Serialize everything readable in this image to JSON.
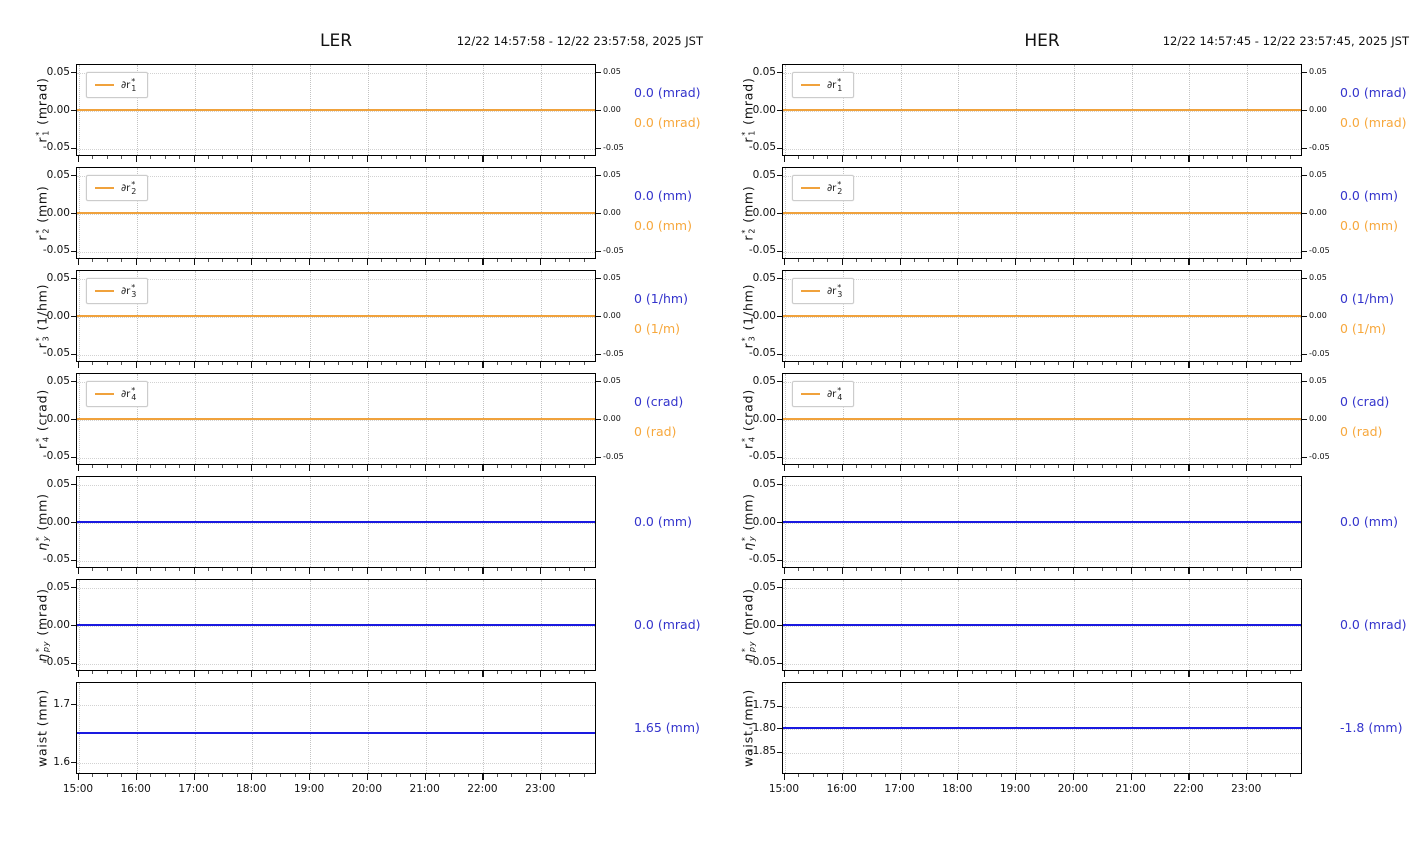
{
  "colors": {
    "orange_line": "#f0a23c",
    "blue_line": "#1a1ae0",
    "orange_text": "#f7a83d",
    "blue_text": "#3434cc",
    "grid": "#c9c9c9",
    "border": "#000000"
  },
  "chart_data": [
    {
      "type": "line",
      "title": "LER",
      "time_range": "12/22 14:57:58 - 12/22 23:57:58, 2025 JST",
      "x_axis": {
        "start": "14:57:58",
        "end": "23:57:58",
        "grid": true
      },
      "x_ticks": [
        {
          "label": "15:00",
          "pos": 0.38
        },
        {
          "label": "16:00",
          "pos": 11.49
        },
        {
          "label": "17:00",
          "pos": 22.6
        },
        {
          "label": "18:00",
          "pos": 33.71
        },
        {
          "label": "19:00",
          "pos": 44.83
        },
        {
          "label": "20:00",
          "pos": 55.94
        },
        {
          "label": "21:00",
          "pos": 67.05
        },
        {
          "label": "22:00",
          "pos": 78.16
        },
        {
          "label": "23:00",
          "pos": 89.27
        }
      ],
      "panels": [
        {
          "id": "r1",
          "ylabel": {
            "base": "r",
            "sup": "*",
            "sub": "1",
            "unit": "(mrad)",
            "italic": false
          },
          "legend": {
            "prefix": "∂r",
            "sup": "*",
            "sub": "1"
          },
          "ylim": [
            -0.055,
            0.055
          ],
          "y_ticks": [
            {
              "label": "0.05",
              "pos": 9
            },
            {
              "label": "0.00",
              "pos": 50
            },
            {
              "label": "-0.05",
              "pos": 91
            }
          ],
          "right_axis": true,
          "series": [
            {
              "name": "∂r1*",
              "color": "orange",
              "value": 0.0,
              "pos": 50
            }
          ],
          "values": [
            {
              "text": "0.0 (mrad)",
              "color": "blue"
            },
            {
              "text": "0.0 (mrad)",
              "color": "orange"
            }
          ]
        },
        {
          "id": "r2",
          "ylabel": {
            "base": "r",
            "sup": "*",
            "sub": "2",
            "unit": "(mm)",
            "italic": false
          },
          "legend": {
            "prefix": "∂r",
            "sup": "*",
            "sub": "2"
          },
          "ylim": [
            -0.055,
            0.055
          ],
          "y_ticks": [
            {
              "label": "0.05",
              "pos": 9
            },
            {
              "label": "0.00",
              "pos": 50
            },
            {
              "label": "-0.05",
              "pos": 91
            }
          ],
          "right_axis": true,
          "series": [
            {
              "name": "∂r2*",
              "color": "orange",
              "value": 0.0,
              "pos": 50
            }
          ],
          "values": [
            {
              "text": "0.0 (mm)",
              "color": "blue"
            },
            {
              "text": "0.0 (mm)",
              "color": "orange"
            }
          ]
        },
        {
          "id": "r3",
          "ylabel": {
            "base": "r",
            "sup": "*",
            "sub": "3",
            "unit": "(1/hm)",
            "italic": false
          },
          "legend": {
            "prefix": "∂r",
            "sup": "*",
            "sub": "3"
          },
          "ylim": [
            -0.055,
            0.055
          ],
          "y_ticks": [
            {
              "label": "0.05",
              "pos": 9
            },
            {
              "label": "0.00",
              "pos": 50
            },
            {
              "label": "-0.05",
              "pos": 91
            }
          ],
          "right_axis": true,
          "series": [
            {
              "name": "∂r3*",
              "color": "orange",
              "value": 0,
              "pos": 50
            }
          ],
          "values": [
            {
              "text": "0 (1/hm)",
              "color": "blue"
            },
            {
              "text": "0 (1/m)",
              "color": "orange"
            }
          ]
        },
        {
          "id": "r4",
          "ylabel": {
            "base": "r",
            "sup": "*",
            "sub": "4",
            "unit": "(crad)",
            "italic": false
          },
          "legend": {
            "prefix": "∂r",
            "sup": "*",
            "sub": "4"
          },
          "ylim": [
            -0.055,
            0.055
          ],
          "y_ticks": [
            {
              "label": "0.05",
              "pos": 9
            },
            {
              "label": "0.00",
              "pos": 50
            },
            {
              "label": "-0.05",
              "pos": 91
            }
          ],
          "right_axis": true,
          "series": [
            {
              "name": "∂r4*",
              "color": "orange",
              "value": 0,
              "pos": 50
            }
          ],
          "values": [
            {
              "text": "0 (crad)",
              "color": "blue"
            },
            {
              "text": "0 (rad)",
              "color": "orange"
            }
          ]
        },
        {
          "id": "eta-y",
          "ylabel": {
            "base": "η",
            "sup": "*",
            "sub": "y",
            "unit": "(mm)",
            "italic": true
          },
          "legend": null,
          "ylim": [
            -0.055,
            0.055
          ],
          "y_ticks": [
            {
              "label": "0.05",
              "pos": 9
            },
            {
              "label": "0.00",
              "pos": 50
            },
            {
              "label": "-0.05",
              "pos": 91
            }
          ],
          "right_axis": false,
          "series": [
            {
              "name": "eta_y*",
              "color": "blue",
              "value": 0.0,
              "pos": 50
            }
          ],
          "values": [
            {
              "text": "0.0 (mm)",
              "color": "blue"
            }
          ]
        },
        {
          "id": "eta-py",
          "ylabel": {
            "base": "η",
            "sup": "*",
            "sub": "py",
            "unit": "(mrad)",
            "italic": true
          },
          "legend": null,
          "ylim": [
            -0.055,
            0.055
          ],
          "y_ticks": [
            {
              "label": "0.05",
              "pos": 9
            },
            {
              "label": "0.00",
              "pos": 50
            },
            {
              "label": "-0.05",
              "pos": 91
            }
          ],
          "right_axis": false,
          "series": [
            {
              "name": "eta_py*",
              "color": "blue",
              "value": 0.0,
              "pos": 50
            }
          ],
          "values": [
            {
              "text": "0.0 (mrad)",
              "color": "blue"
            }
          ]
        },
        {
          "id": "waist",
          "ylabel": {
            "base": "waist",
            "sup": "",
            "sub": "",
            "unit": "(mm)",
            "italic": false
          },
          "legend": null,
          "ylim": [
            1.58,
            1.74
          ],
          "y_ticks": [
            {
              "label": "1.7",
              "pos": 24
            },
            {
              "label": "1.6",
              "pos": 87
            }
          ],
          "right_axis": false,
          "series": [
            {
              "name": "waist",
              "color": "blue",
              "value": 1.65,
              "pos": 55.5
            }
          ],
          "values": [
            {
              "text": "1.65 (mm)",
              "color": "blue"
            }
          ]
        }
      ]
    },
    {
      "type": "line",
      "title": "HER",
      "time_range": "12/22 14:57:45 - 12/22 23:57:45, 2025 JST",
      "x_axis": {
        "start": "14:57:45",
        "end": "23:57:45",
        "grid": true
      },
      "x_ticks": [
        {
          "label": "15:00",
          "pos": 0.38
        },
        {
          "label": "16:00",
          "pos": 11.49
        },
        {
          "label": "17:00",
          "pos": 22.6
        },
        {
          "label": "18:00",
          "pos": 33.71
        },
        {
          "label": "19:00",
          "pos": 44.83
        },
        {
          "label": "20:00",
          "pos": 55.94
        },
        {
          "label": "21:00",
          "pos": 67.05
        },
        {
          "label": "22:00",
          "pos": 78.16
        },
        {
          "label": "23:00",
          "pos": 89.27
        }
      ],
      "panels": [
        {
          "id": "r1",
          "ylabel": {
            "base": "r",
            "sup": "*",
            "sub": "1",
            "unit": "(mrad)",
            "italic": false
          },
          "legend": {
            "prefix": "∂r",
            "sup": "*",
            "sub": "1"
          },
          "ylim": [
            -0.055,
            0.055
          ],
          "y_ticks": [
            {
              "label": "0.05",
              "pos": 9
            },
            {
              "label": "0.00",
              "pos": 50
            },
            {
              "label": "-0.05",
              "pos": 91
            }
          ],
          "right_axis": true,
          "series": [
            {
              "name": "∂r1*",
              "color": "orange",
              "value": 0.0,
              "pos": 50
            }
          ],
          "values": [
            {
              "text": "0.0 (mrad)",
              "color": "blue"
            },
            {
              "text": "0.0 (mrad)",
              "color": "orange"
            }
          ]
        },
        {
          "id": "r2",
          "ylabel": {
            "base": "r",
            "sup": "*",
            "sub": "2",
            "unit": "(mm)",
            "italic": false
          },
          "legend": {
            "prefix": "∂r",
            "sup": "*",
            "sub": "2"
          },
          "ylim": [
            -0.055,
            0.055
          ],
          "y_ticks": [
            {
              "label": "0.05",
              "pos": 9
            },
            {
              "label": "0.00",
              "pos": 50
            },
            {
              "label": "-0.05",
              "pos": 91
            }
          ],
          "right_axis": true,
          "series": [
            {
              "name": "∂r2*",
              "color": "orange",
              "value": 0.0,
              "pos": 50
            }
          ],
          "values": [
            {
              "text": "0.0 (mm)",
              "color": "blue"
            },
            {
              "text": "0.0 (mm)",
              "color": "orange"
            }
          ]
        },
        {
          "id": "r3",
          "ylabel": {
            "base": "r",
            "sup": "*",
            "sub": "3",
            "unit": "(1/hm)",
            "italic": false
          },
          "legend": {
            "prefix": "∂r",
            "sup": "*",
            "sub": "3"
          },
          "ylim": [
            -0.055,
            0.055
          ],
          "y_ticks": [
            {
              "label": "0.05",
              "pos": 9
            },
            {
              "label": "0.00",
              "pos": 50
            },
            {
              "label": "-0.05",
              "pos": 91
            }
          ],
          "right_axis": true,
          "series": [
            {
              "name": "∂r3*",
              "color": "orange",
              "value": 0,
              "pos": 50
            }
          ],
          "values": [
            {
              "text": "0 (1/hm)",
              "color": "blue"
            },
            {
              "text": "0 (1/m)",
              "color": "orange"
            }
          ]
        },
        {
          "id": "r4",
          "ylabel": {
            "base": "r",
            "sup": "*",
            "sub": "4",
            "unit": "(crad)",
            "italic": false
          },
          "legend": {
            "prefix": "∂r",
            "sup": "*",
            "sub": "4"
          },
          "ylim": [
            -0.055,
            0.055
          ],
          "y_ticks": [
            {
              "label": "0.05",
              "pos": 9
            },
            {
              "label": "0.00",
              "pos": 50
            },
            {
              "label": "-0.05",
              "pos": 91
            }
          ],
          "right_axis": true,
          "series": [
            {
              "name": "∂r4*",
              "color": "orange",
              "value": 0,
              "pos": 50
            }
          ],
          "values": [
            {
              "text": "0 (crad)",
              "color": "blue"
            },
            {
              "text": "0 (rad)",
              "color": "orange"
            }
          ]
        },
        {
          "id": "eta-y",
          "ylabel": {
            "base": "η",
            "sup": "*",
            "sub": "y",
            "unit": "(mm)",
            "italic": true
          },
          "legend": null,
          "ylim": [
            -0.055,
            0.055
          ],
          "y_ticks": [
            {
              "label": "0.05",
              "pos": 9
            },
            {
              "label": "0.00",
              "pos": 50
            },
            {
              "label": "-0.05",
              "pos": 91
            }
          ],
          "right_axis": false,
          "series": [
            {
              "name": "eta_y*",
              "color": "blue",
              "value": 0.0,
              "pos": 50
            }
          ],
          "values": [
            {
              "text": "0.0 (mm)",
              "color": "blue"
            }
          ]
        },
        {
          "id": "eta-py",
          "ylabel": {
            "base": "η",
            "sup": "*",
            "sub": "py",
            "unit": "(mrad)",
            "italic": true
          },
          "legend": null,
          "ylim": [
            -0.055,
            0.055
          ],
          "y_ticks": [
            {
              "label": "0.05",
              "pos": 9
            },
            {
              "label": "0.00",
              "pos": 50
            },
            {
              "label": "-0.05",
              "pos": 91
            }
          ],
          "right_axis": false,
          "series": [
            {
              "name": "eta_py*",
              "color": "blue",
              "value": 0.0,
              "pos": 50
            }
          ],
          "values": [
            {
              "text": "0.0 (mrad)",
              "color": "blue"
            }
          ]
        },
        {
          "id": "waist",
          "ylabel": {
            "base": "waist",
            "sup": "",
            "sub": "",
            "unit": "(mm)",
            "italic": false
          },
          "legend": null,
          "ylim": [
            -1.9,
            -1.7
          ],
          "y_ticks": [
            {
              "label": "-1.75",
              "pos": 26
            },
            {
              "label": "-1.80",
              "pos": 50
            },
            {
              "label": "-1.85",
              "pos": 76
            }
          ],
          "right_axis": false,
          "series": [
            {
              "name": "waist",
              "color": "blue",
              "value": -1.8,
              "pos": 50
            }
          ],
          "values": [
            {
              "text": "-1.8 (mm)",
              "color": "blue"
            }
          ]
        }
      ]
    }
  ]
}
